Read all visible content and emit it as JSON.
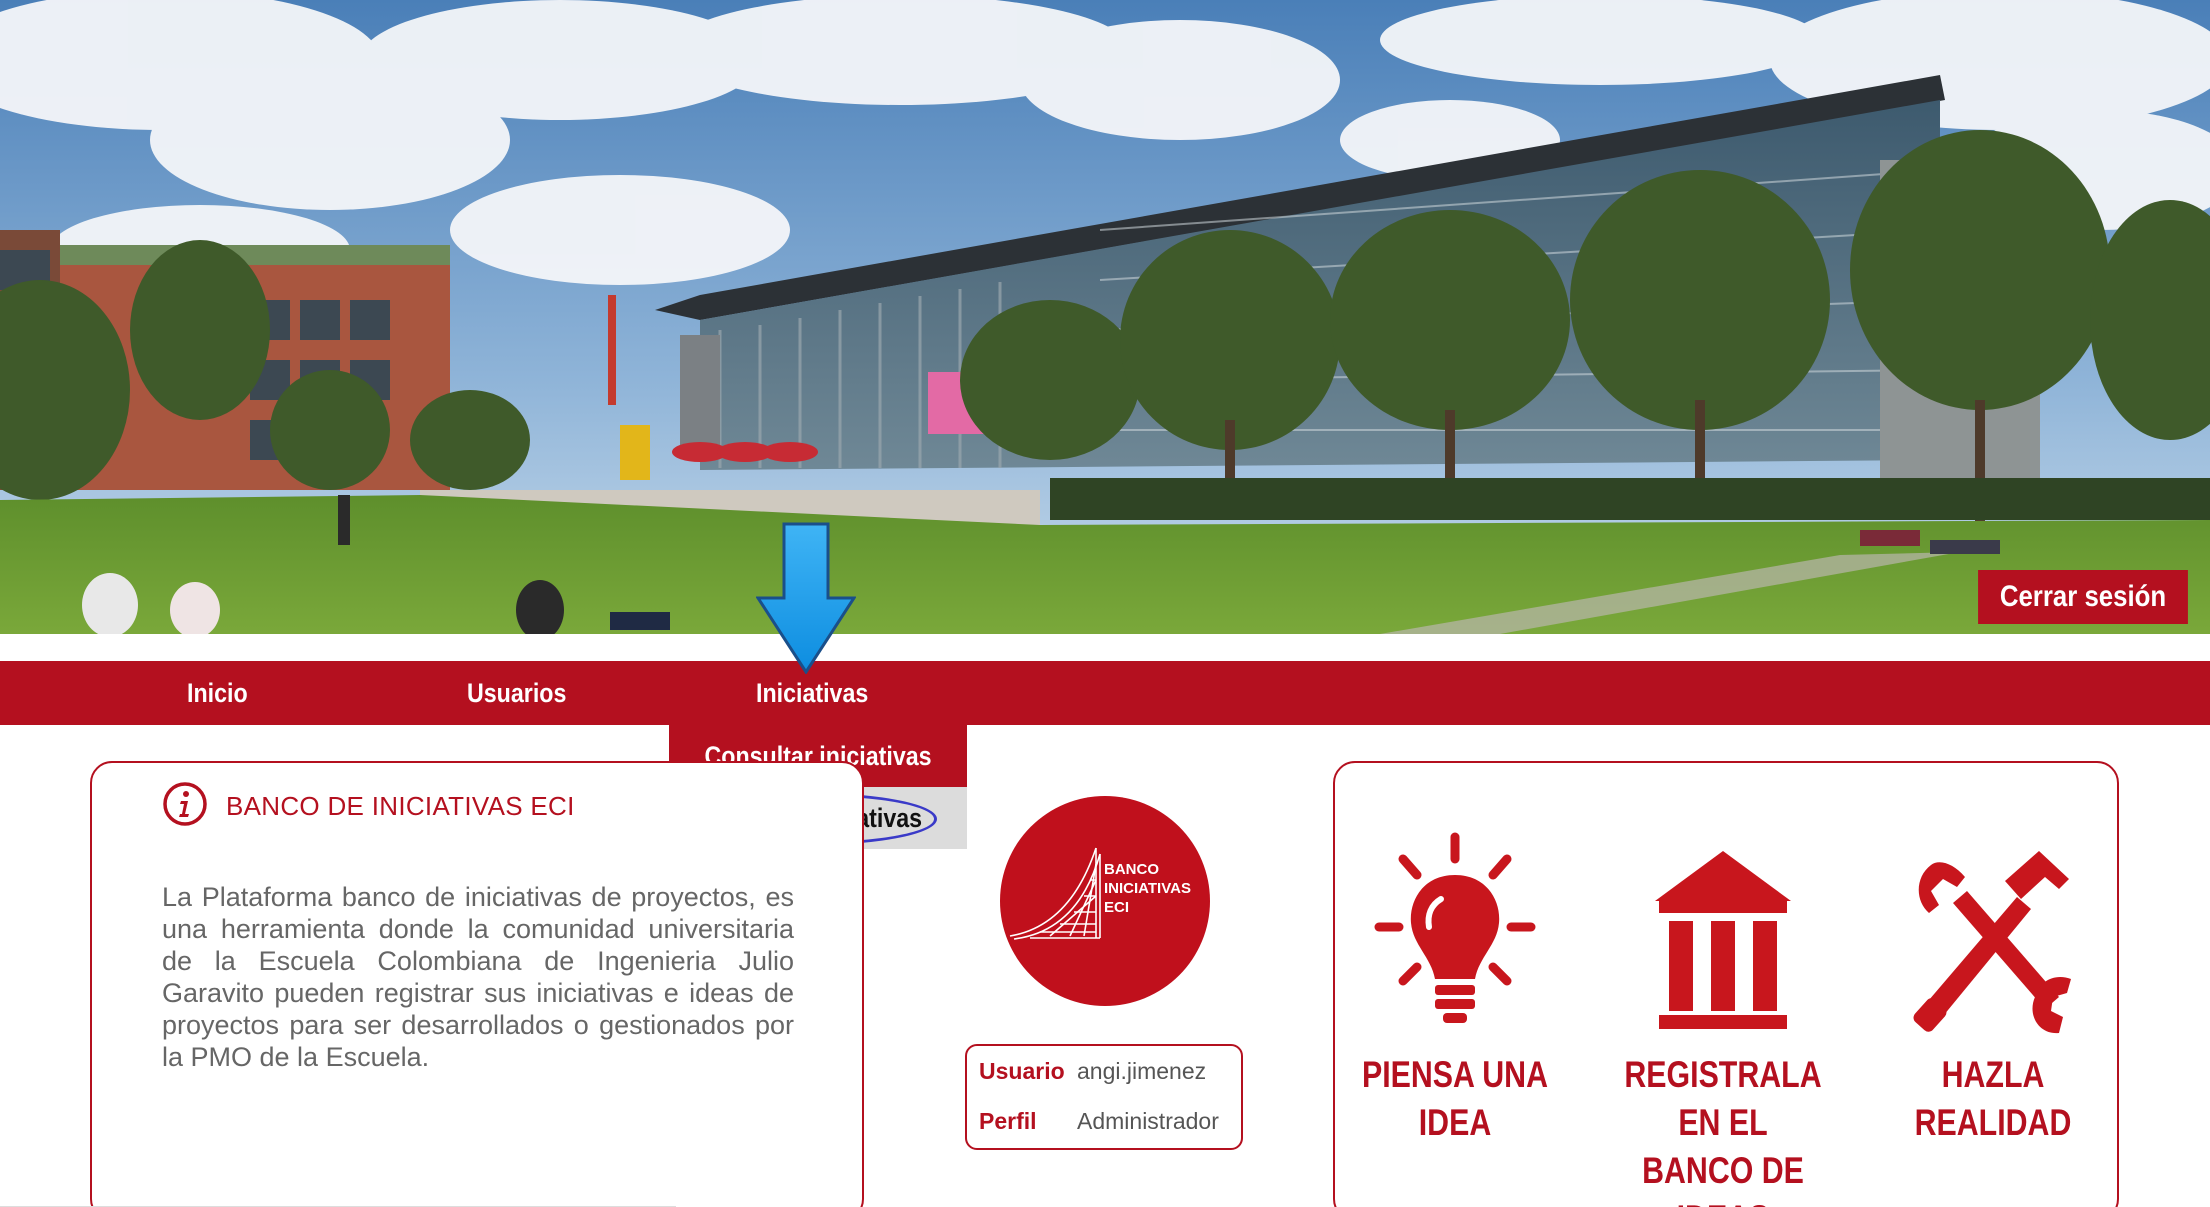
{
  "header": {
    "logout_label": "Cerrar sesión"
  },
  "nav": {
    "items": [
      {
        "label": "Inicio"
      },
      {
        "label": "Usuarios"
      },
      {
        "label": "Iniciativas"
      }
    ],
    "dropdown": {
      "items": [
        {
          "label": "Consultar iniciativas"
        },
        {
          "label": "Agrupar iniciativas"
        }
      ]
    }
  },
  "info": {
    "icon": "info-icon",
    "title": "BANCO DE INICIATIVAS ECI",
    "text": "La Plataforma banco de iniciativas de proyectos, es una herramienta donde la comunidad universitaria de la Escuela Colombiana de Ingenieria Julio Garavito pueden registrar sus iniciativas e ideas de proyectos para ser desarrollados o gestionados por la PMO de la Escuela."
  },
  "logo": {
    "lines": [
      "BANCO",
      "INICIATIVAS",
      "ECI"
    ]
  },
  "user": {
    "user_label": "Usuario",
    "user_value": "angi.jimenez",
    "profile_label": "Perfil",
    "profile_value": "Administrador"
  },
  "steps": [
    {
      "icon": "lightbulb-icon",
      "line1": "PIENSA UNA",
      "line2": "IDEA"
    },
    {
      "icon": "bank-icon",
      "line1": "REGISTRALA EN EL",
      "line2": "BANCO DE IDEAS"
    },
    {
      "icon": "tools-icon",
      "line1": "HAZLA",
      "line2": "REALIDAD"
    }
  ],
  "colors": {
    "brand_red": "#b4101f",
    "annotation_blue": "#1e9ff0",
    "highlight_ellipse": "#3a3ac8"
  }
}
